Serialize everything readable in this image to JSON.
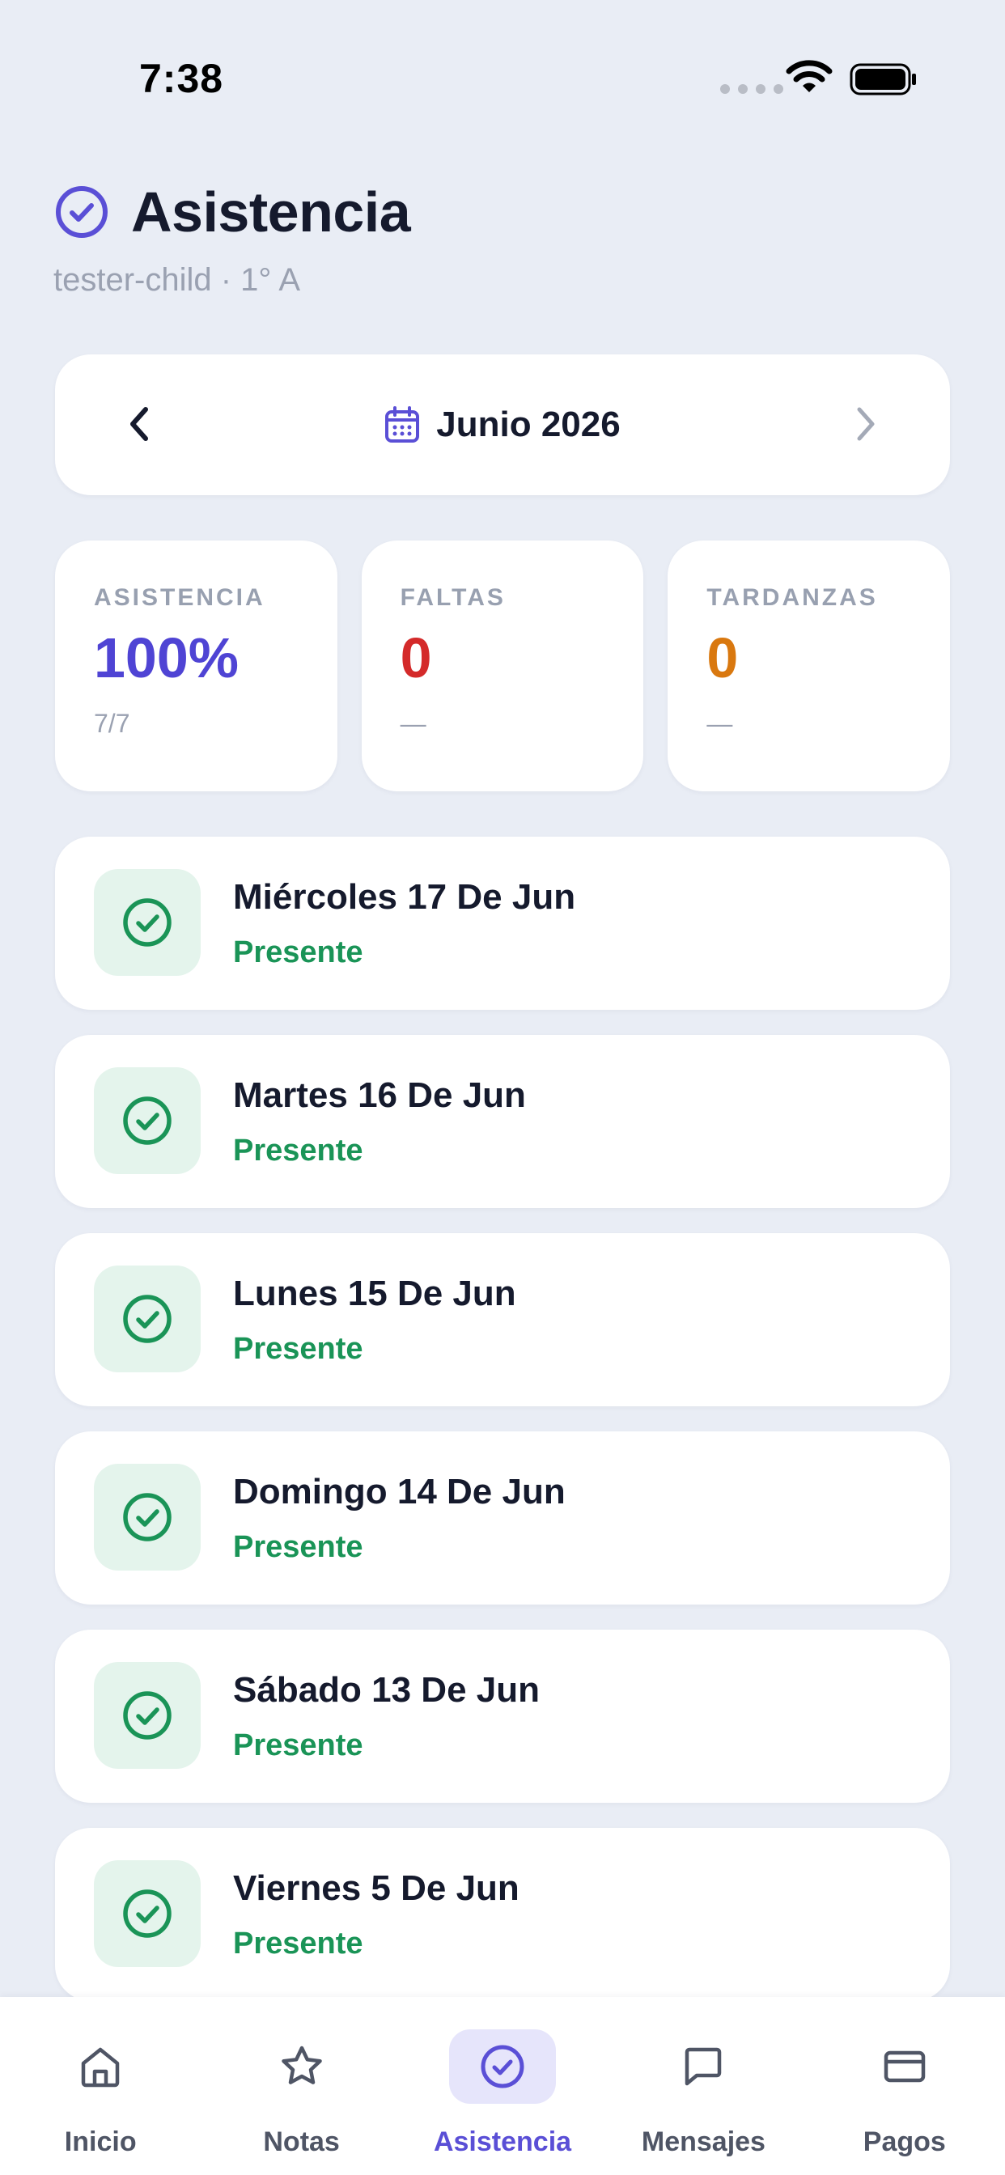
{
  "status_bar": {
    "time": "7:38"
  },
  "header": {
    "title": "Asistencia",
    "subtitle": "tester-child · 1° A"
  },
  "month_selector": {
    "label": "Junio 2026"
  },
  "stats": [
    {
      "label": "ASISTENCIA",
      "value": "100%",
      "sub": "7/7",
      "color": "#4f44d4"
    },
    {
      "label": "FALTAS",
      "value": "0",
      "sub": "—",
      "color": "#d42a2a"
    },
    {
      "label": "TARDANZAS",
      "value": "0",
      "sub": "—",
      "color": "#d9780f"
    }
  ],
  "days": [
    {
      "date": "Miércoles 17 De Jun",
      "status": "Presente"
    },
    {
      "date": "Martes 16 De Jun",
      "status": "Presente"
    },
    {
      "date": "Lunes 15 De Jun",
      "status": "Presente"
    },
    {
      "date": "Domingo 14 De Jun",
      "status": "Presente"
    },
    {
      "date": "Sábado 13 De Jun",
      "status": "Presente"
    },
    {
      "date": "Viernes 5 De Jun",
      "status": "Presente"
    }
  ],
  "tab_bar": {
    "tabs": [
      {
        "label": "Inicio",
        "icon": "home-icon"
      },
      {
        "label": "Notas",
        "icon": "star-icon"
      },
      {
        "label": "Asistencia",
        "icon": "check-circle-icon",
        "active": true
      },
      {
        "label": "Mensajes",
        "icon": "message-icon"
      },
      {
        "label": "Pagos",
        "icon": "card-icon"
      }
    ]
  },
  "colors": {
    "accent": "#5a4fd6",
    "present": "#1a9457",
    "present_bg": "#e4f4ec",
    "background": "#e9edf5"
  }
}
